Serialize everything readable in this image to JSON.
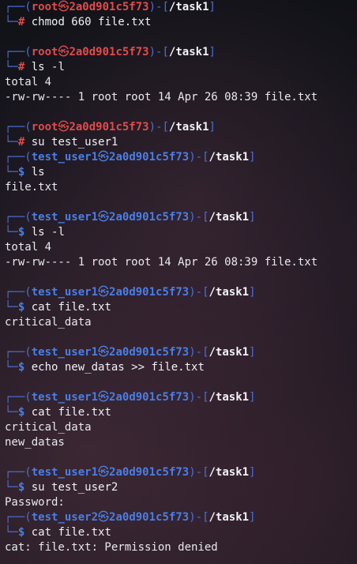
{
  "terminal": {
    "entries": [
      {
        "type": "prompt",
        "user": "root",
        "host": "2a0d901c5f73",
        "dir": "/task1",
        "symbol": "#",
        "command": "chmod 660 file.txt"
      },
      {
        "type": "blank"
      },
      {
        "type": "prompt",
        "user": "root",
        "host": "2a0d901c5f73",
        "dir": "/task1",
        "symbol": "#",
        "command": "ls -l"
      },
      {
        "type": "output",
        "text": "total 4"
      },
      {
        "type": "output",
        "text": "-rw-rw---- 1 root root 14 Apr 26 08:39 file.txt"
      },
      {
        "type": "blank"
      },
      {
        "type": "prompt",
        "user": "root",
        "host": "2a0d901c5f73",
        "dir": "/task1",
        "symbol": "#",
        "command": "su test_user1"
      },
      {
        "type": "prompt",
        "user": "test_user1",
        "host": "2a0d901c5f73",
        "dir": "/task1",
        "symbol": "$",
        "command": "ls"
      },
      {
        "type": "output",
        "text": "file.txt"
      },
      {
        "type": "blank"
      },
      {
        "type": "prompt",
        "user": "test_user1",
        "host": "2a0d901c5f73",
        "dir": "/task1",
        "symbol": "$",
        "command": "ls -l"
      },
      {
        "type": "output",
        "text": "total 4"
      },
      {
        "type": "output",
        "text": "-rw-rw---- 1 root root 14 Apr 26 08:39 file.txt"
      },
      {
        "type": "blank"
      },
      {
        "type": "prompt",
        "user": "test_user1",
        "host": "2a0d901c5f73",
        "dir": "/task1",
        "symbol": "$",
        "command": "cat file.txt"
      },
      {
        "type": "output",
        "text": "critical_data"
      },
      {
        "type": "blank"
      },
      {
        "type": "prompt",
        "user": "test_user1",
        "host": "2a0d901c5f73",
        "dir": "/task1",
        "symbol": "$",
        "command": "echo new_datas >> file.txt"
      },
      {
        "type": "blank"
      },
      {
        "type": "prompt",
        "user": "test_user1",
        "host": "2a0d901c5f73",
        "dir": "/task1",
        "symbol": "$",
        "command": "cat file.txt"
      },
      {
        "type": "output",
        "text": "critical_data"
      },
      {
        "type": "output",
        "text": "new_datas"
      },
      {
        "type": "blank"
      },
      {
        "type": "prompt",
        "user": "test_user1",
        "host": "2a0d901c5f73",
        "dir": "/task1",
        "symbol": "$",
        "command": "su test_user2"
      },
      {
        "type": "output",
        "text": "Password:"
      },
      {
        "type": "prompt",
        "user": "test_user2",
        "host": "2a0d901c5f73",
        "dir": "/task1",
        "symbol": "$",
        "command": "cat file.txt"
      },
      {
        "type": "output",
        "text": "cat: file.txt: Permission denied"
      }
    ],
    "box_top": "┌──",
    "box_bottom": "└─",
    "separator_glyph": "㉿",
    "open_paren": "(",
    "close_paren": ")",
    "dash": "-",
    "open_bracket": "[",
    "close_bracket": "]"
  }
}
